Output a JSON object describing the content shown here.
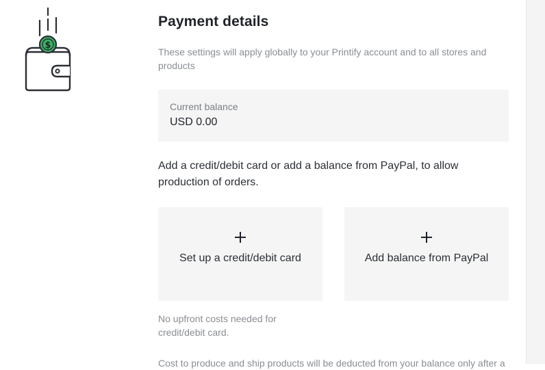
{
  "header": {
    "title": "Payment details",
    "subtitle": "These settings will apply globally to your Printify account and to all stores and products"
  },
  "balance": {
    "label": "Current balance",
    "value": "USD 0.00"
  },
  "instruction": "Add a credit/debit card or add a balance from PayPal, to allow production of orders.",
  "options": {
    "credit_card": {
      "icon": "plus-icon",
      "label": "Set up a credit/debit card"
    },
    "paypal": {
      "icon": "plus-icon",
      "label": "Add balance from PayPal"
    }
  },
  "note": "No upfront costs needed for credit/debit card.",
  "footnote": "Cost to produce and ship products will be deducted from your balance only after a",
  "illustration": {
    "icon": "wallet-coin-icon",
    "coin_symbol": "$"
  },
  "colors": {
    "accent_green": "#3bb365",
    "panel_bg": "#f5f5f5",
    "muted_text": "#8a8d93"
  }
}
